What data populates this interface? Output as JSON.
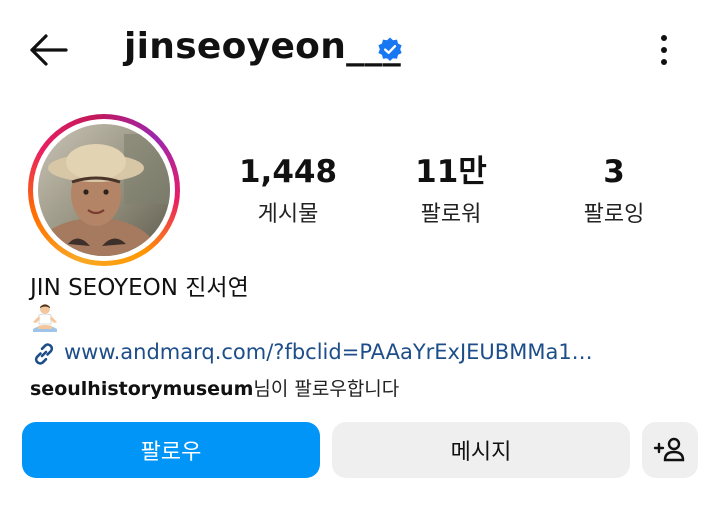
{
  "header": {
    "username": "jinseoyeon___",
    "back_icon": "arrow-left-icon",
    "verified_icon": "verified-badge-icon",
    "more_icon": "more-vertical-icon",
    "verified_color": "#1877f2"
  },
  "profile": {
    "avatar_icon": "profile-photo",
    "stats": [
      {
        "value": "1,448",
        "label": "게시물"
      },
      {
        "value": "11만",
        "label": "팔로워"
      },
      {
        "value": "3",
        "label": "팔로잉"
      }
    ],
    "full_name": "JIN SEOYEON 진서연",
    "emoji_icon": "person-lotus-position-emoji",
    "link_icon": "link-icon",
    "link": "www.andmarq.com/?fbclid=PAAaYrExJEUBMMa1…",
    "followed_by_user": "seoulhistorymuseum",
    "followed_by_suffix": "님이 팔로우합니다"
  },
  "actions": {
    "follow_label": "팔로우",
    "message_label": "메시지",
    "add_icon": "add-person-icon",
    "follow_color": "#0095f6",
    "secondary_color": "#efefef"
  }
}
